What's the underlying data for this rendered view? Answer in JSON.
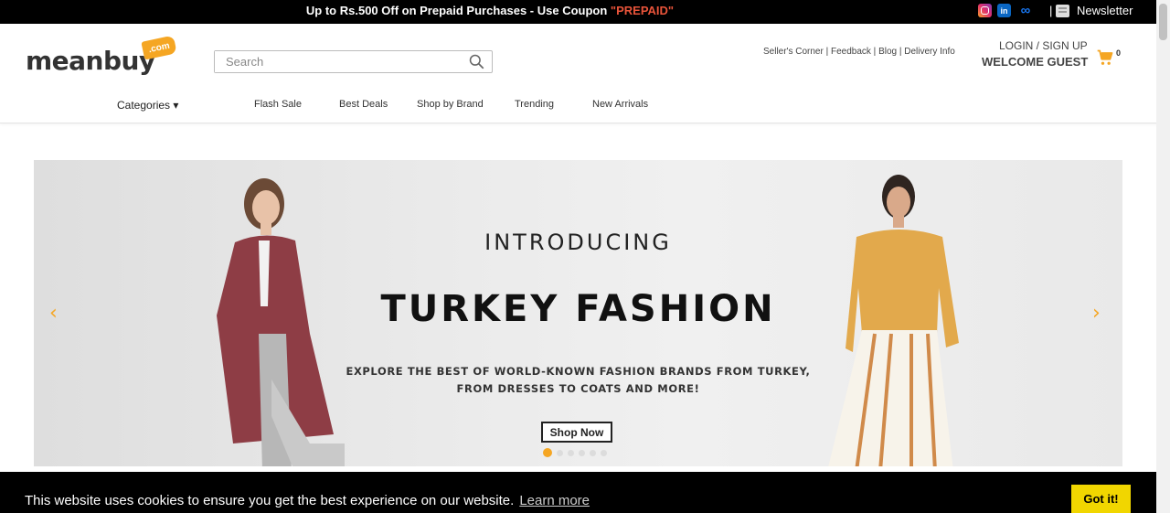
{
  "topbar": {
    "promo_text": "Up to Rs.500 Off on Prepaid Purchases - Use Coupon ",
    "coupon_code": "\"PREPAID\"",
    "separator": "|",
    "newsletter_label": "Newsletter",
    "social_icons": [
      "instagram-icon",
      "linkedin-icon",
      "meta-icon"
    ]
  },
  "header": {
    "logo_word": "meanbuy",
    "logo_tag": ".com",
    "search_placeholder": "Search",
    "search_value": "",
    "links": [
      "Seller's Corner",
      "Feedback",
      "Blog",
      "Delivery Info"
    ],
    "link_separator": " | ",
    "login_label": "LOGIN / SIGN UP",
    "welcome_label": "WELCOME GUEST",
    "cart_count": "0"
  },
  "nav": {
    "categories_label": "Categories ▾",
    "items": [
      "Flash Sale",
      "Best Deals",
      "Shop by Brand",
      "Trending",
      "New Arrivals"
    ]
  },
  "banner": {
    "intro": "INTRODUCING",
    "headline": "TURKEY FASHION",
    "sub_line1": "EXPLORE THE BEST OF WORLD-KNOWN FASHION BRANDS FROM TURKEY,",
    "sub_line2": "FROM DRESSES TO COATS AND MORE!",
    "button_label": "Shop Now",
    "prev_arrow": "‹",
    "next_arrow": "›",
    "slide_count": 6,
    "active_slide": 1
  },
  "cookie": {
    "message": "This website uses cookies to ensure you get the best experience on our website.",
    "learn_more": "Learn more",
    "button_label": "Got it!"
  },
  "colors": {
    "accent": "#f5a623",
    "coupon": "#e9543a",
    "cookie_button": "#f1d600",
    "topbar_bg": "#000000"
  }
}
